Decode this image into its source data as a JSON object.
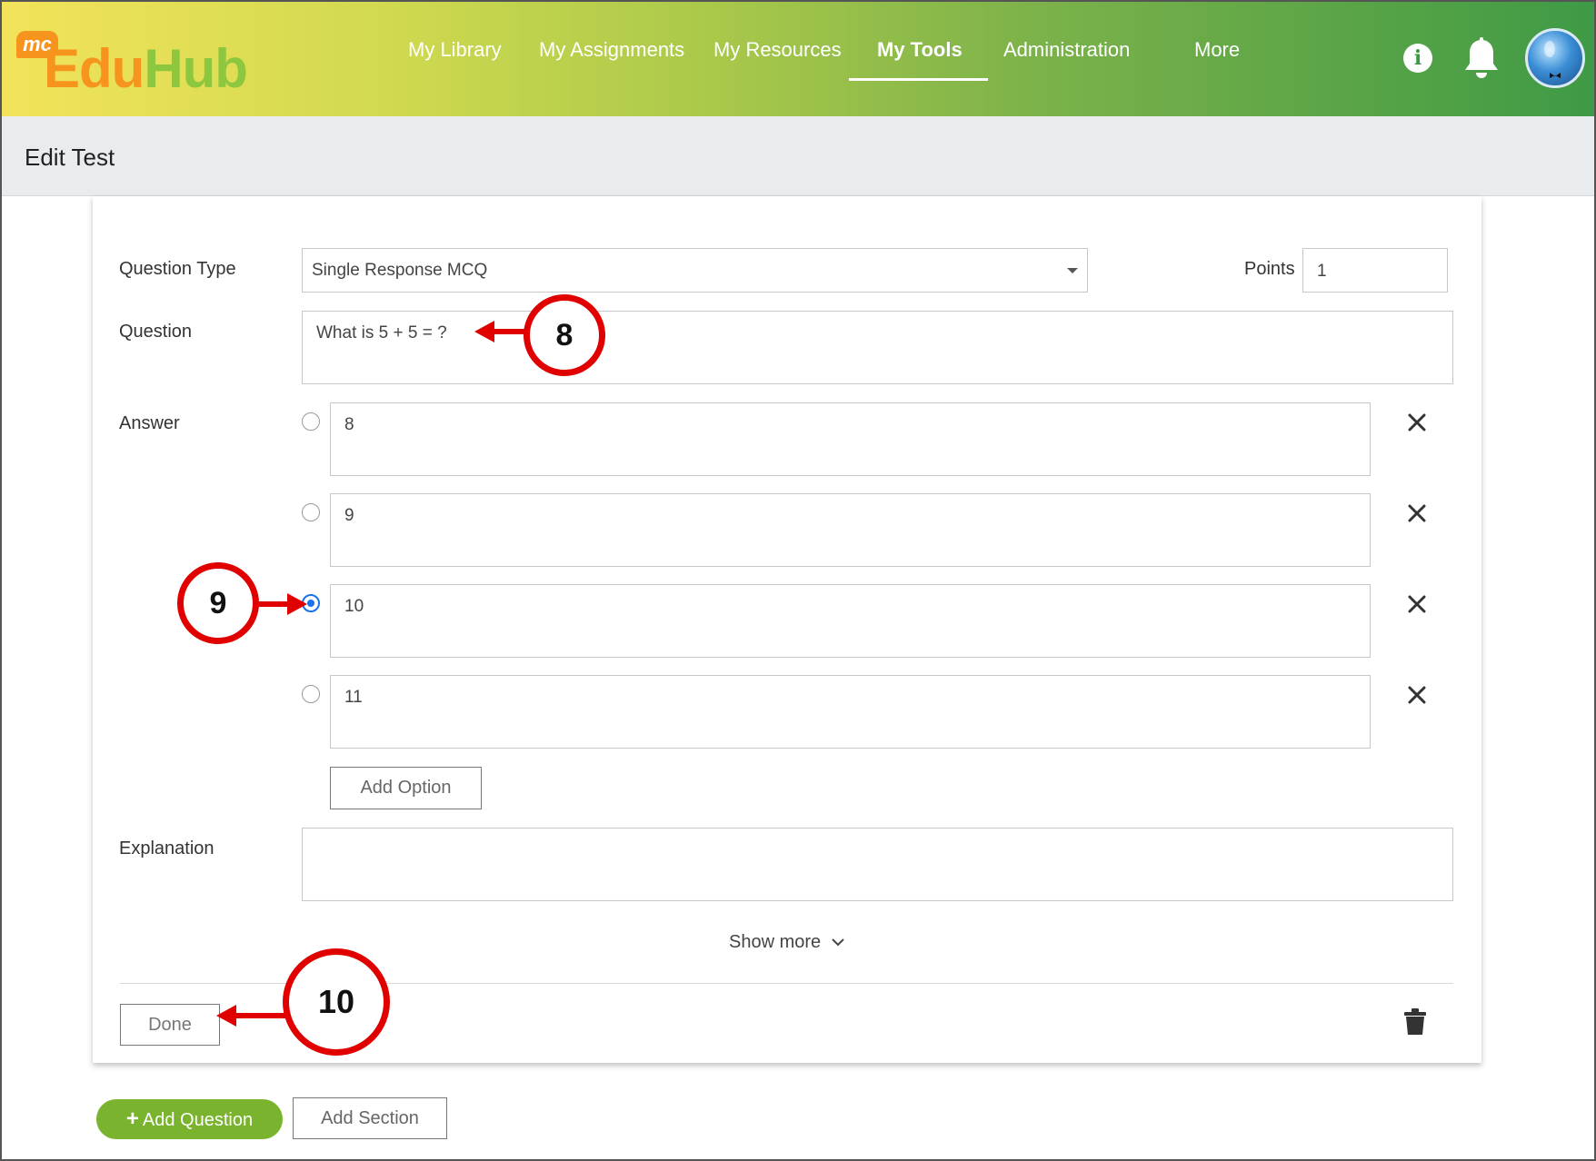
{
  "app": {
    "logo_badge": "mc",
    "logo_part1": "Edu",
    "logo_part2": "Hub"
  },
  "nav": {
    "items": [
      {
        "label": "My Library"
      },
      {
        "label": "My Assignments"
      },
      {
        "label": "My Resources"
      },
      {
        "label": "My Tools",
        "active": true
      },
      {
        "label": "Administration"
      },
      {
        "label": "More"
      }
    ]
  },
  "header_icons": {
    "info": "i",
    "info_icon": "info-icon",
    "bell_icon": "bell-icon",
    "avatar_icon": "avatar"
  },
  "page": {
    "title": "Edit Test"
  },
  "form": {
    "question_type_label": "Question Type",
    "question_type_value": "Single Response MCQ",
    "points_label": "Points",
    "points_value": "1",
    "question_label": "Question",
    "question_value": "What is 5 + 5 = ?",
    "answer_label": "Answer",
    "answers": [
      {
        "value": "8",
        "selected": false
      },
      {
        "value": "9",
        "selected": false
      },
      {
        "value": "10",
        "selected": true
      },
      {
        "value": "11",
        "selected": false
      }
    ],
    "add_option_label": "Add Option",
    "explanation_label": "Explanation",
    "explanation_value": "",
    "show_more_label": "Show more",
    "done_label": "Done"
  },
  "footer": {
    "add_question_label": "Add Question",
    "add_section_label": "Add Section"
  },
  "annotations": {
    "step_8": "8",
    "step_9": "9",
    "step_10": "10"
  },
  "colors": {
    "accent_green": "#7ab32d",
    "radio_blue": "#1a73e8",
    "annotation_red": "#e00000",
    "logo_orange": "#f7941d"
  }
}
